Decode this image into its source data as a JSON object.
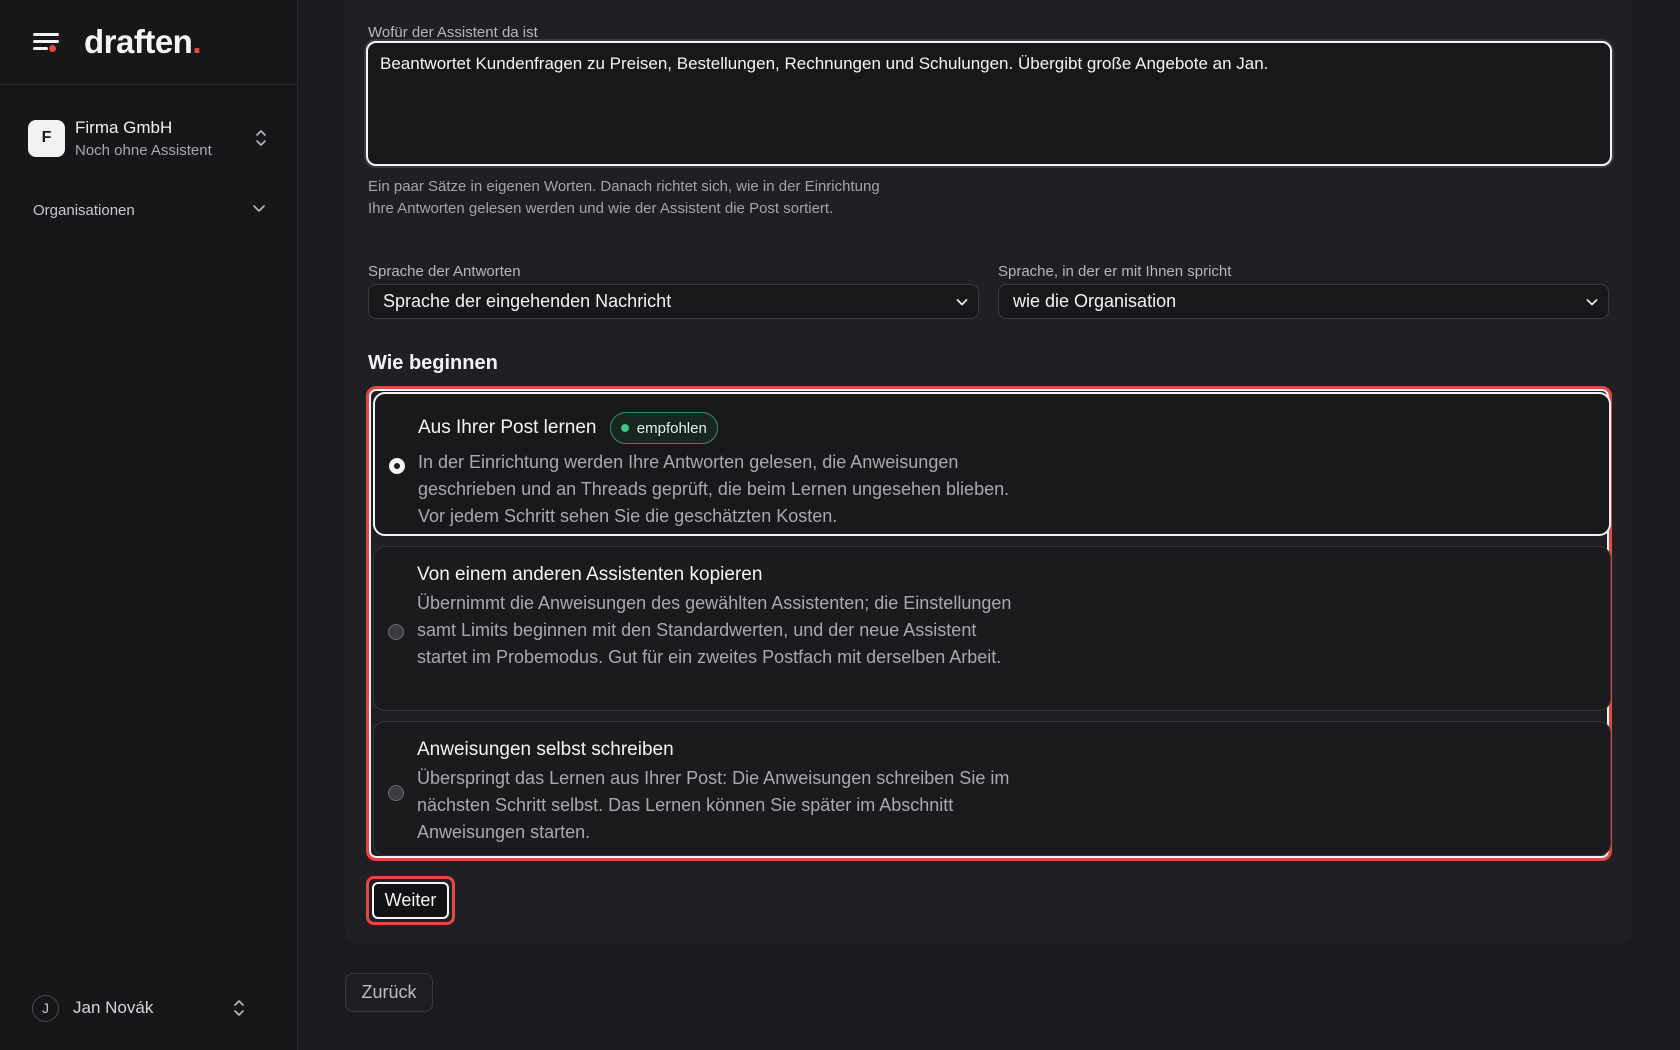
{
  "app": {
    "logo_text": "draften",
    "logo_dot": "."
  },
  "sidebar": {
    "org": {
      "initial": "F",
      "name": "Firma GmbH",
      "subtitle": "Noch ohne Assistent"
    },
    "nav": {
      "organizations": "Organisationen"
    },
    "user": {
      "initial": "J",
      "name": "Jan Novák"
    }
  },
  "form": {
    "purpose_label": "Wofür der Assistent da ist",
    "purpose_value": "Beantwortet Kundenfragen zu Preisen, Bestellungen, Rechnungen und Schulungen. Übergibt große Angebote an Jan.",
    "purpose_help": "Ein paar Sätze in eigenen Worten. Danach richtet sich, wie in der Einrichtung Ihre Antworten gelesen werden und wie der Assistent die Post sortiert.",
    "reply_language_label": "Sprache der Antworten",
    "reply_language_value": "Sprache der eingehenden Nachricht",
    "talk_language_label": "Sprache, in der er mit Ihnen spricht",
    "talk_language_value": "wie die Organisation",
    "start_title": "Wie beginnen",
    "options": [
      {
        "title": "Aus Ihrer Post lernen",
        "badge": "empfohlen",
        "selected": true,
        "description": "In der Einrichtung werden Ihre Antworten gelesen, die Anweisungen geschrieben und an Threads geprüft, die beim Lernen ungesehen blieben. Vor jedem Schritt sehen Sie die geschätzten Kosten."
      },
      {
        "title": "Von einem anderen Assistenten kopieren",
        "selected": false,
        "description": "Übernimmt die Anweisungen des gewählten Assistenten; die Einstellungen samt Limits beginnen mit den Standardwerten, und der neue Assistent startet im Probemodus. Gut für ein zweites Postfach mit derselben Arbeit."
      },
      {
        "title": "Anweisungen selbst schreiben",
        "selected": false,
        "description": "Überspringt das Lernen aus Ihrer Post: Die Anweisungen schreiben Sie im nächsten Schritt selbst. Das Lernen können Sie später im Abschnitt Anweisungen starten."
      }
    ],
    "next_button": "Weiter",
    "back_button": "Zurück"
  },
  "colors": {
    "accent": "#e5483f",
    "badge_green": "#3fc486",
    "background": "#1c1c20",
    "sidebar": "#17171a"
  },
  "icons": [
    "menu-icon",
    "updown-chevron-icon",
    "chevron-down-icon",
    "radio-icon",
    "status-dot-icon"
  ]
}
